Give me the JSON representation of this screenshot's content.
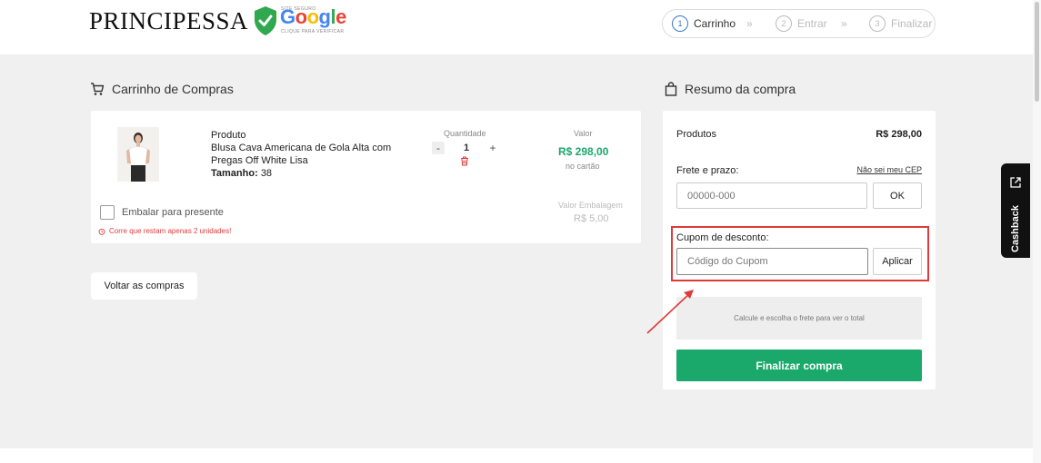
{
  "header": {
    "logo": "PRINCIPESSA",
    "seal": {
      "top_text": "SITE SEGURO",
      "brand": "Google",
      "bottom_text": "CLIQUE PARA VERIFICAR",
      "shield_color": "#2fa84f"
    },
    "steps": [
      {
        "num": "1",
        "label": "Carrinho",
        "active": true
      },
      {
        "num": "2",
        "label": "Entrar",
        "active": false
      },
      {
        "num": "3",
        "label": "Finalizar",
        "active": false
      }
    ],
    "step_separator": "»"
  },
  "cart": {
    "title": "Carrinho de Compras",
    "item": {
      "product_label": "Produto",
      "name": "Blusa Cava Americana de Gola Alta com Pregas Off White Lisa",
      "size_label": "Tamanho:",
      "size_value": "38",
      "quantity_label": "Quantidade",
      "quantity": "1",
      "minus": "-",
      "plus": "+",
      "value_label": "Valor",
      "price": "R$ 298,00",
      "price_note": "no cartão"
    },
    "gift_label": "Embalar para presente",
    "wrap_value_label": "Valor Embalagem",
    "wrap_price": "R$ 5,00",
    "stock_warning": "Corre que restam apenas 2 unidades!",
    "back_button": "Voltar as compras"
  },
  "summary": {
    "title": "Resumo da compra",
    "products_label": "Produtos",
    "products_value": "R$ 298,00",
    "shipping_label": "Frete e prazo:",
    "cep_link": "Não sei meu CEP",
    "cep_placeholder": "00000-000",
    "ok_button": "OK",
    "coupon_label": "Cupom de desconto:",
    "coupon_placeholder": "Código do Cupom",
    "apply_button": "Aplicar",
    "calc_note": "Calcule e escolha o frete para ver o total",
    "finish_button": "Finalizar compra"
  },
  "cashback": {
    "label": "Cashback"
  },
  "colors": {
    "accent_green": "#1aa86b",
    "highlight_red": "#e03a3a",
    "step_active": "#3a78c6"
  }
}
